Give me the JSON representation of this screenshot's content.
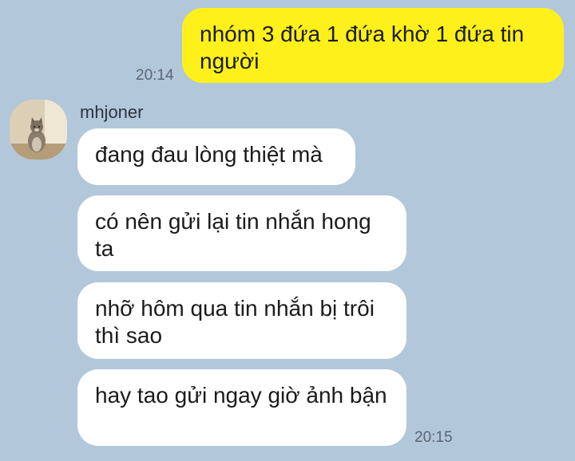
{
  "chat": {
    "outgoing": [
      {
        "text": "nhóm 3 đứa 1 đứa khờ 1 đứa tin người",
        "time": "20:14"
      }
    ],
    "incoming": {
      "sender": "mhjoner",
      "avatar_icon": "cat-photo-avatar",
      "messages": [
        {
          "text": "đang đau lòng thiệt mà"
        },
        {
          "text": "có nên gửi lại tin nhắn hong ta"
        },
        {
          "text": "nhỡ hôm qua tin nhắn bị trôi thì sao"
        },
        {
          "text": "hay tao gửi ngay giờ ảnh bận"
        }
      ],
      "time": "20:15"
    },
    "colors": {
      "background": "#b2c7da",
      "outgoing_bubble": "#fef01b",
      "incoming_bubble": "#ffffff"
    }
  }
}
